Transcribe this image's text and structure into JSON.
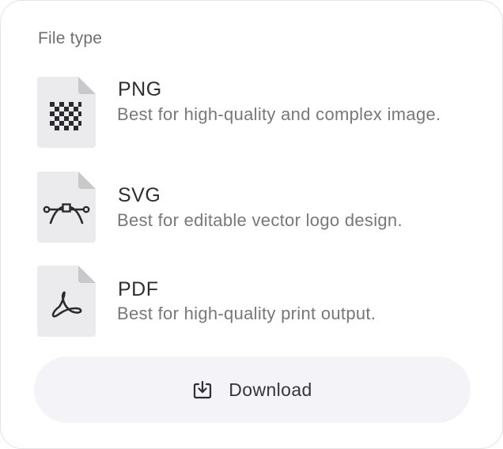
{
  "panel": {
    "title": "File type"
  },
  "file_types": [
    {
      "name": "PNG",
      "description": "Best for high-quality and complex image.",
      "icon": "checkerboard-icon"
    },
    {
      "name": "SVG",
      "description": "Best for editable vector logo design.",
      "icon": "bezier-pen-icon"
    },
    {
      "name": "PDF",
      "description": "Best for high-quality print output.",
      "icon": "pdf-acrobat-icon"
    }
  ],
  "download_button": {
    "label": "Download",
    "icon": "download-tray-icon"
  },
  "colors": {
    "card_border": "#e3e3e8",
    "file_icon_bg": "#ebebed",
    "file_icon_fold": "#c9c9cc",
    "title_text": "#2e2e33",
    "desc_text": "#77777c",
    "button_bg": "#f4f4f8"
  }
}
